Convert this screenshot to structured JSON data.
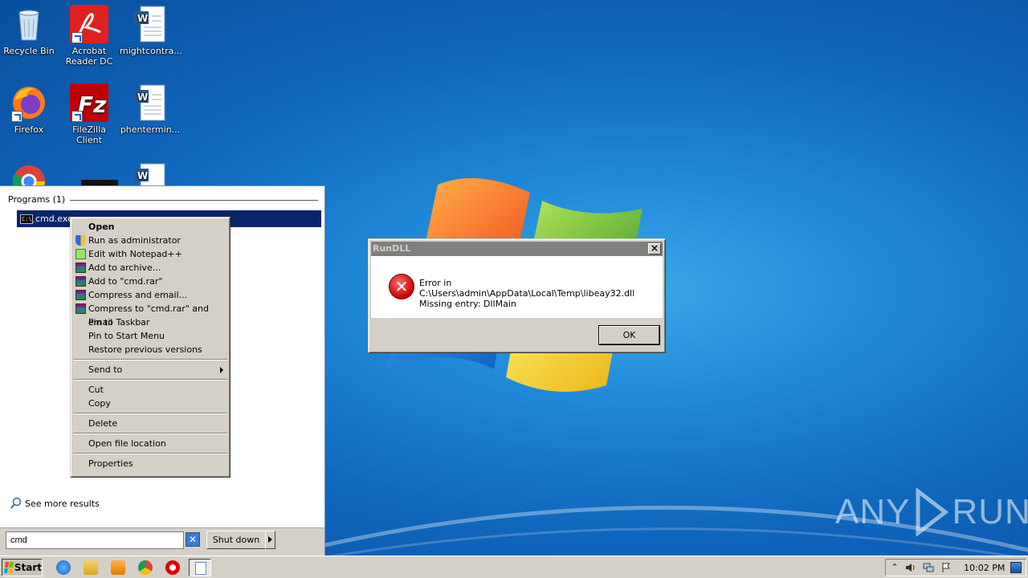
{
  "desktop": {
    "icons": [
      {
        "label": "Recycle Bin",
        "icon": "recycle-bin-icon"
      },
      {
        "label": "Acrobat Reader DC",
        "icon": "acrobat-icon"
      },
      {
        "label": "mightcontra...",
        "icon": "word-doc-icon"
      },
      {
        "label": "Firefox",
        "icon": "firefox-icon"
      },
      {
        "label": "FileZilla Client",
        "icon": "filezilla-icon"
      },
      {
        "label": "phentermin...",
        "icon": "word-doc-icon"
      }
    ]
  },
  "start_menu": {
    "section_title": "Programs (1)",
    "result_label": "cmd.exe",
    "see_more": "See more results",
    "search_value": "cmd",
    "shutdown_label": "Shut down"
  },
  "context_menu": {
    "items": [
      {
        "label": "Open",
        "bold": true
      },
      {
        "label": "Run as administrator",
        "icon": "uac-shield-icon"
      },
      {
        "label": "Edit with Notepad++",
        "icon": "notepadpp-icon"
      },
      {
        "label": "Add to archive...",
        "icon": "winrar-icon"
      },
      {
        "label": "Add to \"cmd.rar\"",
        "icon": "winrar-icon"
      },
      {
        "label": "Compress and email...",
        "icon": "winrar-icon"
      },
      {
        "label": "Compress to \"cmd.rar\" and email",
        "icon": "winrar-icon"
      },
      {
        "label": "Pin to Taskbar"
      },
      {
        "label": "Pin to Start Menu"
      },
      {
        "label": "Restore previous versions"
      },
      {
        "label": "Send to"
      },
      {
        "label": "Cut"
      },
      {
        "label": "Copy"
      },
      {
        "label": "Delete"
      },
      {
        "label": "Open file location"
      },
      {
        "label": "Properties"
      }
    ]
  },
  "dialog": {
    "title": "RunDLL",
    "message_line1": "Error in C:\\Users\\admin\\AppData\\Local\\Temp\\libeay32.dll",
    "message_line2": "Missing entry: DllMain",
    "ok_label": "OK"
  },
  "watermark": {
    "left": "ANY",
    "right": "RUN"
  },
  "taskbar": {
    "start_label": "Start",
    "clock": "10:02 PM"
  }
}
